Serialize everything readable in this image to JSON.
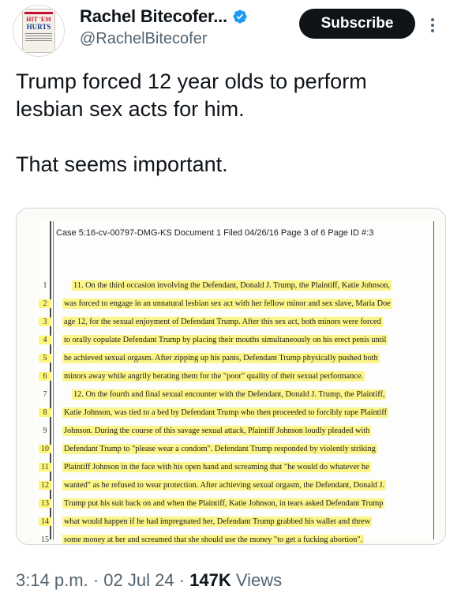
{
  "author": {
    "display_name": "Rachel Bitecofer...",
    "handle": "@RachelBitecofer",
    "verified": true,
    "verified_icon": "verified-badge-icon",
    "avatar_text_top": "HIT 'EM",
    "avatar_text_bottom": "HURTS"
  },
  "actions": {
    "subscribe_label": "Subscribe",
    "more_icon": "more-vertical-icon"
  },
  "tweet": {
    "line1": "Trump forced 12 year olds to perform",
    "line2": "lesbian sex acts for him.",
    "line3": "That seems important."
  },
  "document": {
    "header": "Case 5:16-cv-00797-DMG-KS   Document 1   Filed 04/26/16   Page 3 of 6   Page ID #:3",
    "lines": [
      {
        "no": "1",
        "text": "11.  On the third occasion involving the Defendant, Donald J. Trump, the Plaintiff, Katie Johnson,"
      },
      {
        "no": "2",
        "text": "was forced to engage in an unnatural lesbian sex act with her fellow minor and sex slave, Maria Doe"
      },
      {
        "no": "3",
        "text": "age 12, for the sexual enjoyment of Defendant Trump.  After this sex act, both minors were forced"
      },
      {
        "no": "4",
        "text": "to orally copulate Defendant Trump by placing their mouths simultaneously on his erect penis until"
      },
      {
        "no": "5",
        "text": "he achieved sexual orgasm.  After zipping up his pants, Defendant Trump physically pushed both"
      },
      {
        "no": "6",
        "text": "minors away while angrily berating them for the \"poor\" quality of their sexual performance."
      },
      {
        "no": "7",
        "text": "12.  On the fourth and final sexual encounter with the Defendant, Donald J. Trump, the Plaintiff,"
      },
      {
        "no": "8",
        "text": "Katie Johnson, was tied to a bed by Defendant Trump who then proceeded to forcibly rape Plaintiff"
      },
      {
        "no": "9",
        "text": "Johnson.  During the course of this savage sexual attack, Plaintiff Johnson loudly pleaded with"
      },
      {
        "no": "10",
        "text": "Defendant Trump to \"please wear a condom\".  Defendant Trump responded by violently striking"
      },
      {
        "no": "11",
        "text": "Plaintiff Johnson in the face with his open hand and screaming that \"he would do whatever he"
      },
      {
        "no": "12",
        "text": "wanted\" as he refused to wear protection.  After achieving sexual orgasm, the Defendant, Donald J."
      },
      {
        "no": "13",
        "text": "Trump put his suit back on and when the Plaintiff, Katie Johnson, in tears asked Defendant Trump"
      },
      {
        "no": "14",
        "text": "what would happen if he had impregnated her, Defendant Trump grabbed his wallet and threw"
      },
      {
        "no": "15",
        "text": "some money at her and screamed that she should use the money \"to get a fucking abortion\"."
      }
    ]
  },
  "footer": {
    "time": "3:14 p.m.",
    "sep1": " · ",
    "date": "02 Jul 24",
    "sep2": " · ",
    "views_count": "147K",
    "views_label": " Views"
  },
  "colors": {
    "subscribe_bg": "#0f1419",
    "verified": "#1d9bf0",
    "highlight": "#fbf58a",
    "secondary_text": "#536471"
  }
}
